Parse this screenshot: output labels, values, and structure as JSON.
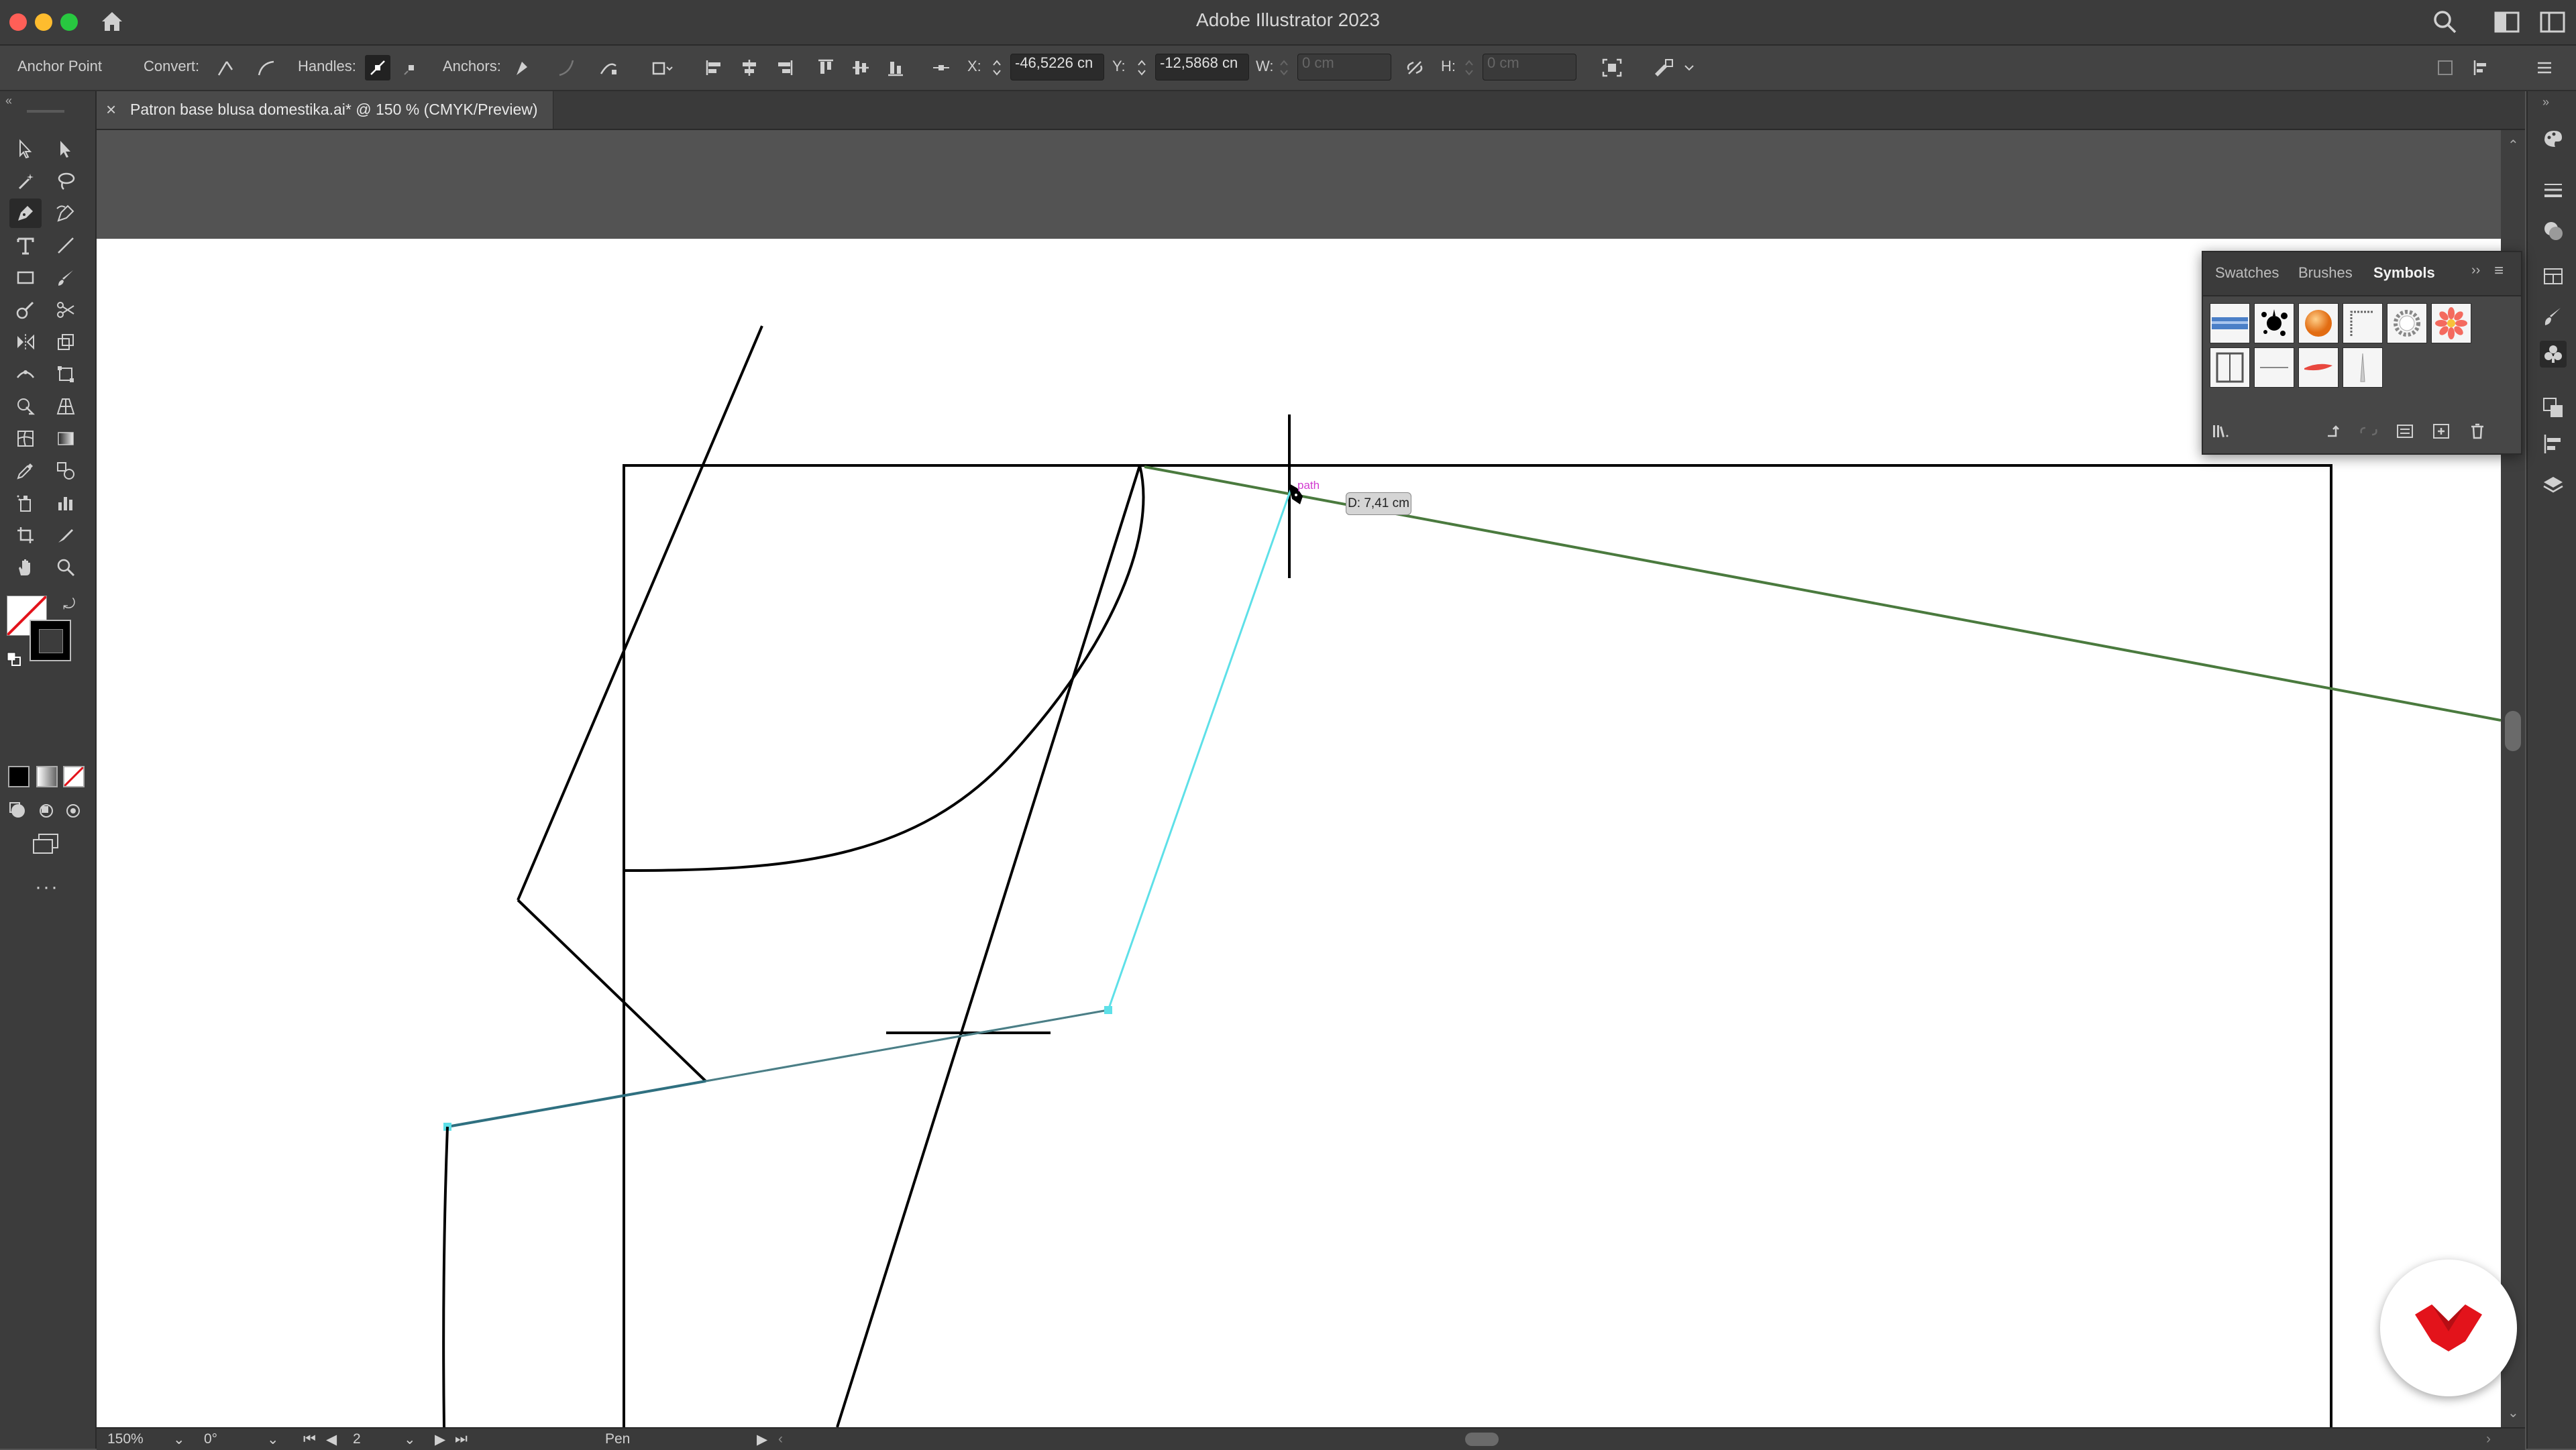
{
  "window": {
    "title": "Adobe Illustrator 2023",
    "traffic_lights": {
      "close": "#ff5f57",
      "minimize": "#febc2e",
      "zoom": "#28c840"
    }
  },
  "control_bar": {
    "context_label": "Anchor Point",
    "convert_label": "Convert:",
    "handles_label": "Handles:",
    "anchors_label": "Anchors:",
    "x_label": "X:",
    "x_value": "-46,5226 cn",
    "y_label": "Y:",
    "y_value": "-12,5868 cn",
    "w_label": "W:",
    "w_value": "0 cm",
    "h_label": "H:",
    "h_value": "0 cm"
  },
  "document_tab": {
    "label": "Patron base blusa domestika.ai* @ 150 % (CMYK/Preview)",
    "close": "×"
  },
  "symbols_panel": {
    "tabs": [
      "Swatches",
      "Brushes",
      "Symbols"
    ],
    "active_tab": "Symbols",
    "symbols": [
      "blue-banner",
      "ink-splat",
      "orange-sphere",
      "rope-frame",
      "gear-ring",
      "pink-flower",
      "column-frame",
      "thin-rule",
      "red-brush-stroke",
      "candle-spike"
    ]
  },
  "canvas": {
    "distance_tooltip": "D: 7,41 cm",
    "path_hint": "path",
    "selection_color": "#5ee0e8",
    "guide_color": "#4a7a3e"
  },
  "status_bar": {
    "zoom": "150%",
    "rotation": "0°",
    "artboard_number": "2",
    "current_tool": "Pen"
  },
  "brand": {
    "badge_color": "#e3131b"
  }
}
